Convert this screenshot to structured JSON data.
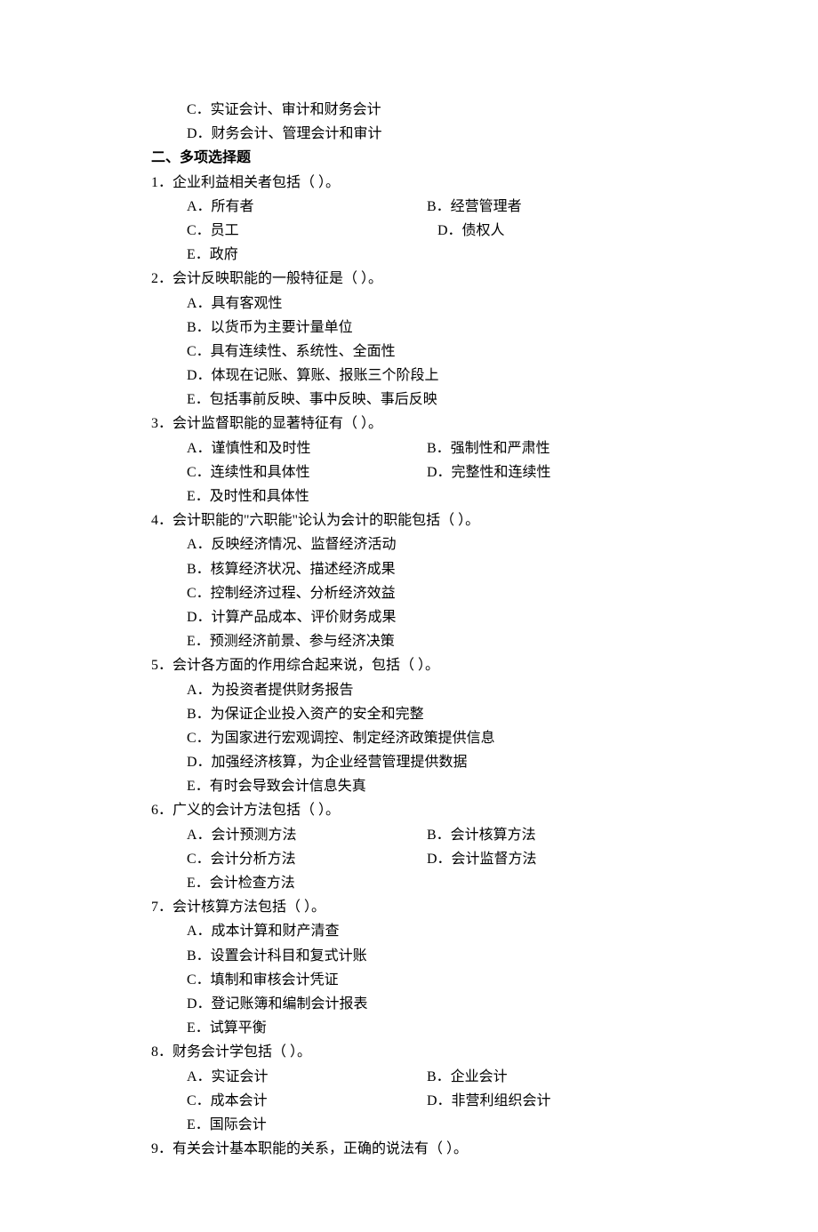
{
  "preOptions": {
    "c": "C．实证会计、审计和财务会计",
    "d": "D．财务会计、管理会计和审计"
  },
  "sectionHeading": "二、多项选择题",
  "questions": [
    {
      "stem": "1．企业利益相关者包括（   ）。",
      "pairs": [
        {
          "left": "A．所有者",
          "right": "B．经营管理者"
        },
        {
          "left": "C．员工",
          "right": "   D．债权人"
        }
      ],
      "tail": [
        "E．政府"
      ]
    },
    {
      "stem": "2．会计反映职能的一般特征是（   ）。",
      "lines": [
        "A．具有客观性",
        "B．以货币为主要计量单位",
        "C．具有连续性、系统性、全面性",
        "D．体现在记账、算账、报账三个阶段上",
        "E．包括事前反映、事中反映、事后反映"
      ]
    },
    {
      "stem": "3．会计监督职能的显著特征有（    ）。",
      "pairs": [
        {
          "left": "A．谨慎性和及时性",
          "right": "B．强制性和严肃性"
        },
        {
          "left": "C．连续性和具体性",
          "right": "D．完整性和连续性"
        }
      ],
      "tail": [
        "E．及时性和具体性"
      ]
    },
    {
      "stem": "4．会计职能的\"六职能\"论认为会计的职能包括（    ）。",
      "lines": [
        "A．反映经济情况、监督经济活动",
        "B．核算经济状况、描述经济成果",
        "C．控制经济过程、分析经济效益",
        "D．计算产品成本、评价财务成果",
        "E．预测经济前景、参与经济决策"
      ]
    },
    {
      "stem": "5．会计各方面的作用综合起来说，包括（    ）。",
      "lines": [
        "A．为投资者提供财务报告",
        "B．为保证企业投入资产的安全和完整",
        "C．为国家进行宏观调控、制定经济政策提供信息",
        "D．加强经济核算，为企业经营管理提供数据",
        "E．有时会导致会计信息失真"
      ]
    },
    {
      "stem": "6．广义的会计方法包括（    ）。",
      "pairs": [
        {
          "left": "A．会计预测方法",
          "right": "B．会计核算方法"
        },
        {
          "left": "C．会计分析方法",
          "right": "D．会计监督方法"
        }
      ],
      "tail": [
        "E．会计检查方法"
      ]
    },
    {
      "stem": "7．会计核算方法包括（    ）。",
      "lines": [
        "A．成本计算和财产清查",
        "B．设置会计科目和复式计账",
        "C．填制和审核会计凭证",
        "D．登记账簿和编制会计报表",
        "E．试算平衡"
      ]
    },
    {
      "stem": "8．财务会计学包括（    ）。",
      "pairs": [
        {
          "left": "A．实证会计",
          "right": "B．企业会计"
        },
        {
          "left": "C．成本会计",
          "right": "D．非营利组织会计"
        }
      ],
      "tail": [
        "E．国际会计"
      ]
    },
    {
      "stem": "9．有关会计基本职能的关系，正确的说法有（    ）。"
    }
  ]
}
